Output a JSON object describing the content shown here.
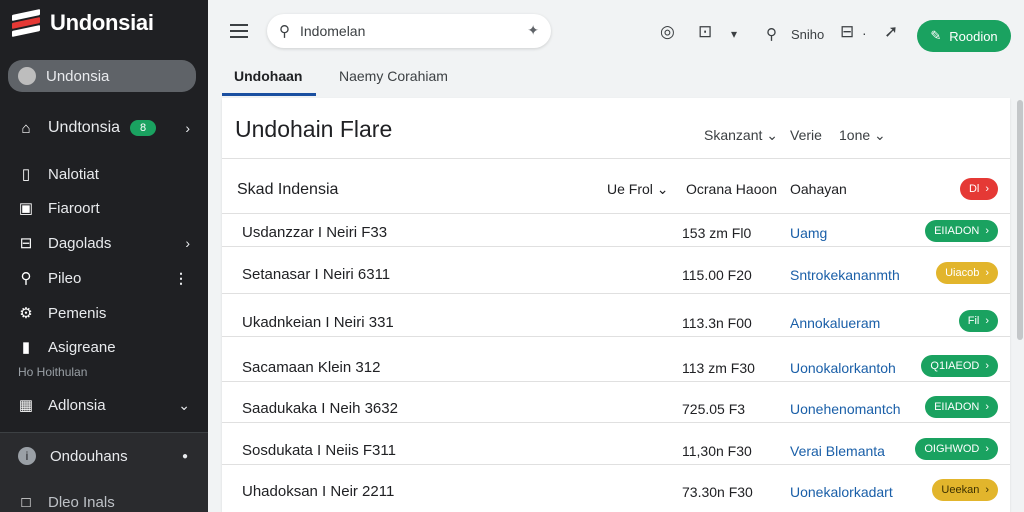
{
  "app": {
    "logo": "Undonsiai"
  },
  "sidebar": {
    "active": "Undonsia",
    "items": [
      {
        "label": "Undtonsia",
        "badge": "8"
      },
      {
        "label": "Nalotiat"
      },
      {
        "label": "Fiaroort"
      },
      {
        "label": "Dagolads"
      },
      {
        "label": "Pileo"
      },
      {
        "label": "Pemenis"
      },
      {
        "label": "Asigreane"
      },
      {
        "label": "Adlonsia"
      }
    ],
    "section": "Ho Hoithulan",
    "lower": [
      {
        "label": "Ondouhans"
      },
      {
        "label": "Dleo Inals"
      }
    ]
  },
  "search": {
    "value": "Indomelan"
  },
  "toolbar": {
    "label1": "Sniho",
    "primary": "Roodion"
  },
  "tabs": [
    {
      "label": "Undohaan"
    },
    {
      "label": "Naemy Corahiam"
    }
  ],
  "card": {
    "title": "Undohain  Flare",
    "ctrl1": "Skanzant",
    "ctrl2": "Verie",
    "ctrl3": "1one",
    "header": {
      "name": "Skad Indensia",
      "col1": "Ue Frol",
      "col2": "Ocrana Haoon",
      "col3": "Oahayan",
      "action": "Dl"
    },
    "rows": [
      {
        "name": "Usdanzzar I Neiri F33",
        "time": "153 zm Fl0",
        "link": "Uamg",
        "status": "EIIADON",
        "color": "green"
      },
      {
        "name": "Setanasar I Neiri 6311",
        "time": "115.00 F20",
        "link": "Sntrokekananmth",
        "status": "Uiacob",
        "color": "yellow"
      },
      {
        "name": "Ukadnkeian I Neiri 331",
        "time": "113.3n F00",
        "link": "Annokalueram",
        "status": "Fil",
        "color": "green"
      },
      {
        "name": "Sacamaan Klein 312",
        "time": "113 zm F30",
        "link": "Uonokalorkantoh",
        "status": "Q1IAEOD",
        "color": "green"
      },
      {
        "name": "Saadukaka I Neih 3632",
        "time": "725.05 F3",
        "link": "Uonehenomantch",
        "status": "EIIADON",
        "color": "green"
      },
      {
        "name": "Sosdukata I Neiis F311",
        "time": "11,30n F30",
        "link": "Verai Blemanta",
        "status": "OIGHWOD",
        "color": "green"
      },
      {
        "name": "Uhadoksan I Neir 2211",
        "time": "73.30n F30",
        "link": "Uonekalorkadart",
        "status": "Ueekan",
        "color": "yellow-dark"
      }
    ]
  },
  "colors": {
    "sidebar": "#1f2023",
    "accent": "#1aa260",
    "link": "#1a5fa8",
    "danger": "#e53935",
    "warn": "#e2b52c"
  }
}
